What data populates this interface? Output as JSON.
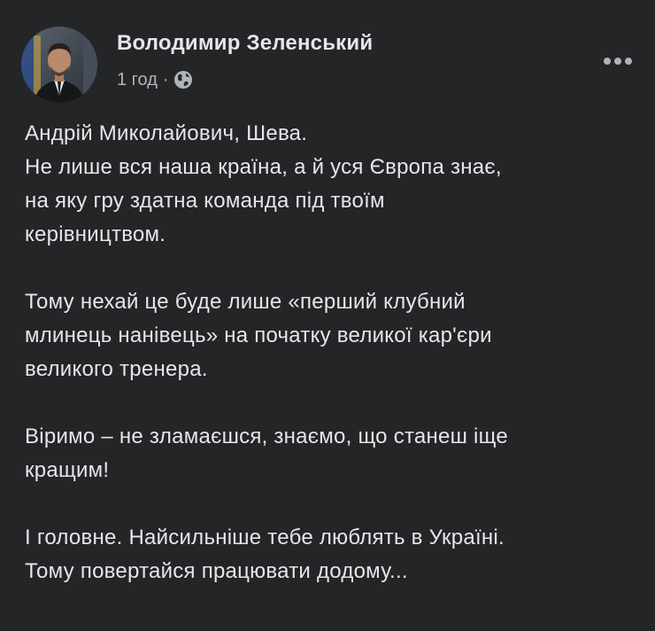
{
  "post": {
    "author": "Володимир Зеленський",
    "time": "1 год",
    "separator": "·",
    "privacy_icon": "globe-icon",
    "more_icon": "more-options-icon",
    "paragraphs": [
      [
        "Андрій Миколайович, Шева.",
        "Не лише вся наша країна, а й уся Європа знає,",
        "на яку гру здатна команда під твоїм",
        "керівництвом."
      ],
      [
        "Тому нехай це буде лише «перший клубний",
        "млинець нанівець» на початку великої кар'єри",
        "великого тренера."
      ],
      [
        "Віримо – не зламаєшся, знаємо, що станеш іще",
        "кращим!"
      ],
      [
        "І головне. Найсильніше тебе люблять в Україні.",
        "Тому повертайся працювати додому..."
      ]
    ]
  },
  "colors": {
    "background": "#242526",
    "primary_text": "#e4e6eb",
    "secondary_text": "#b0b3b8"
  }
}
